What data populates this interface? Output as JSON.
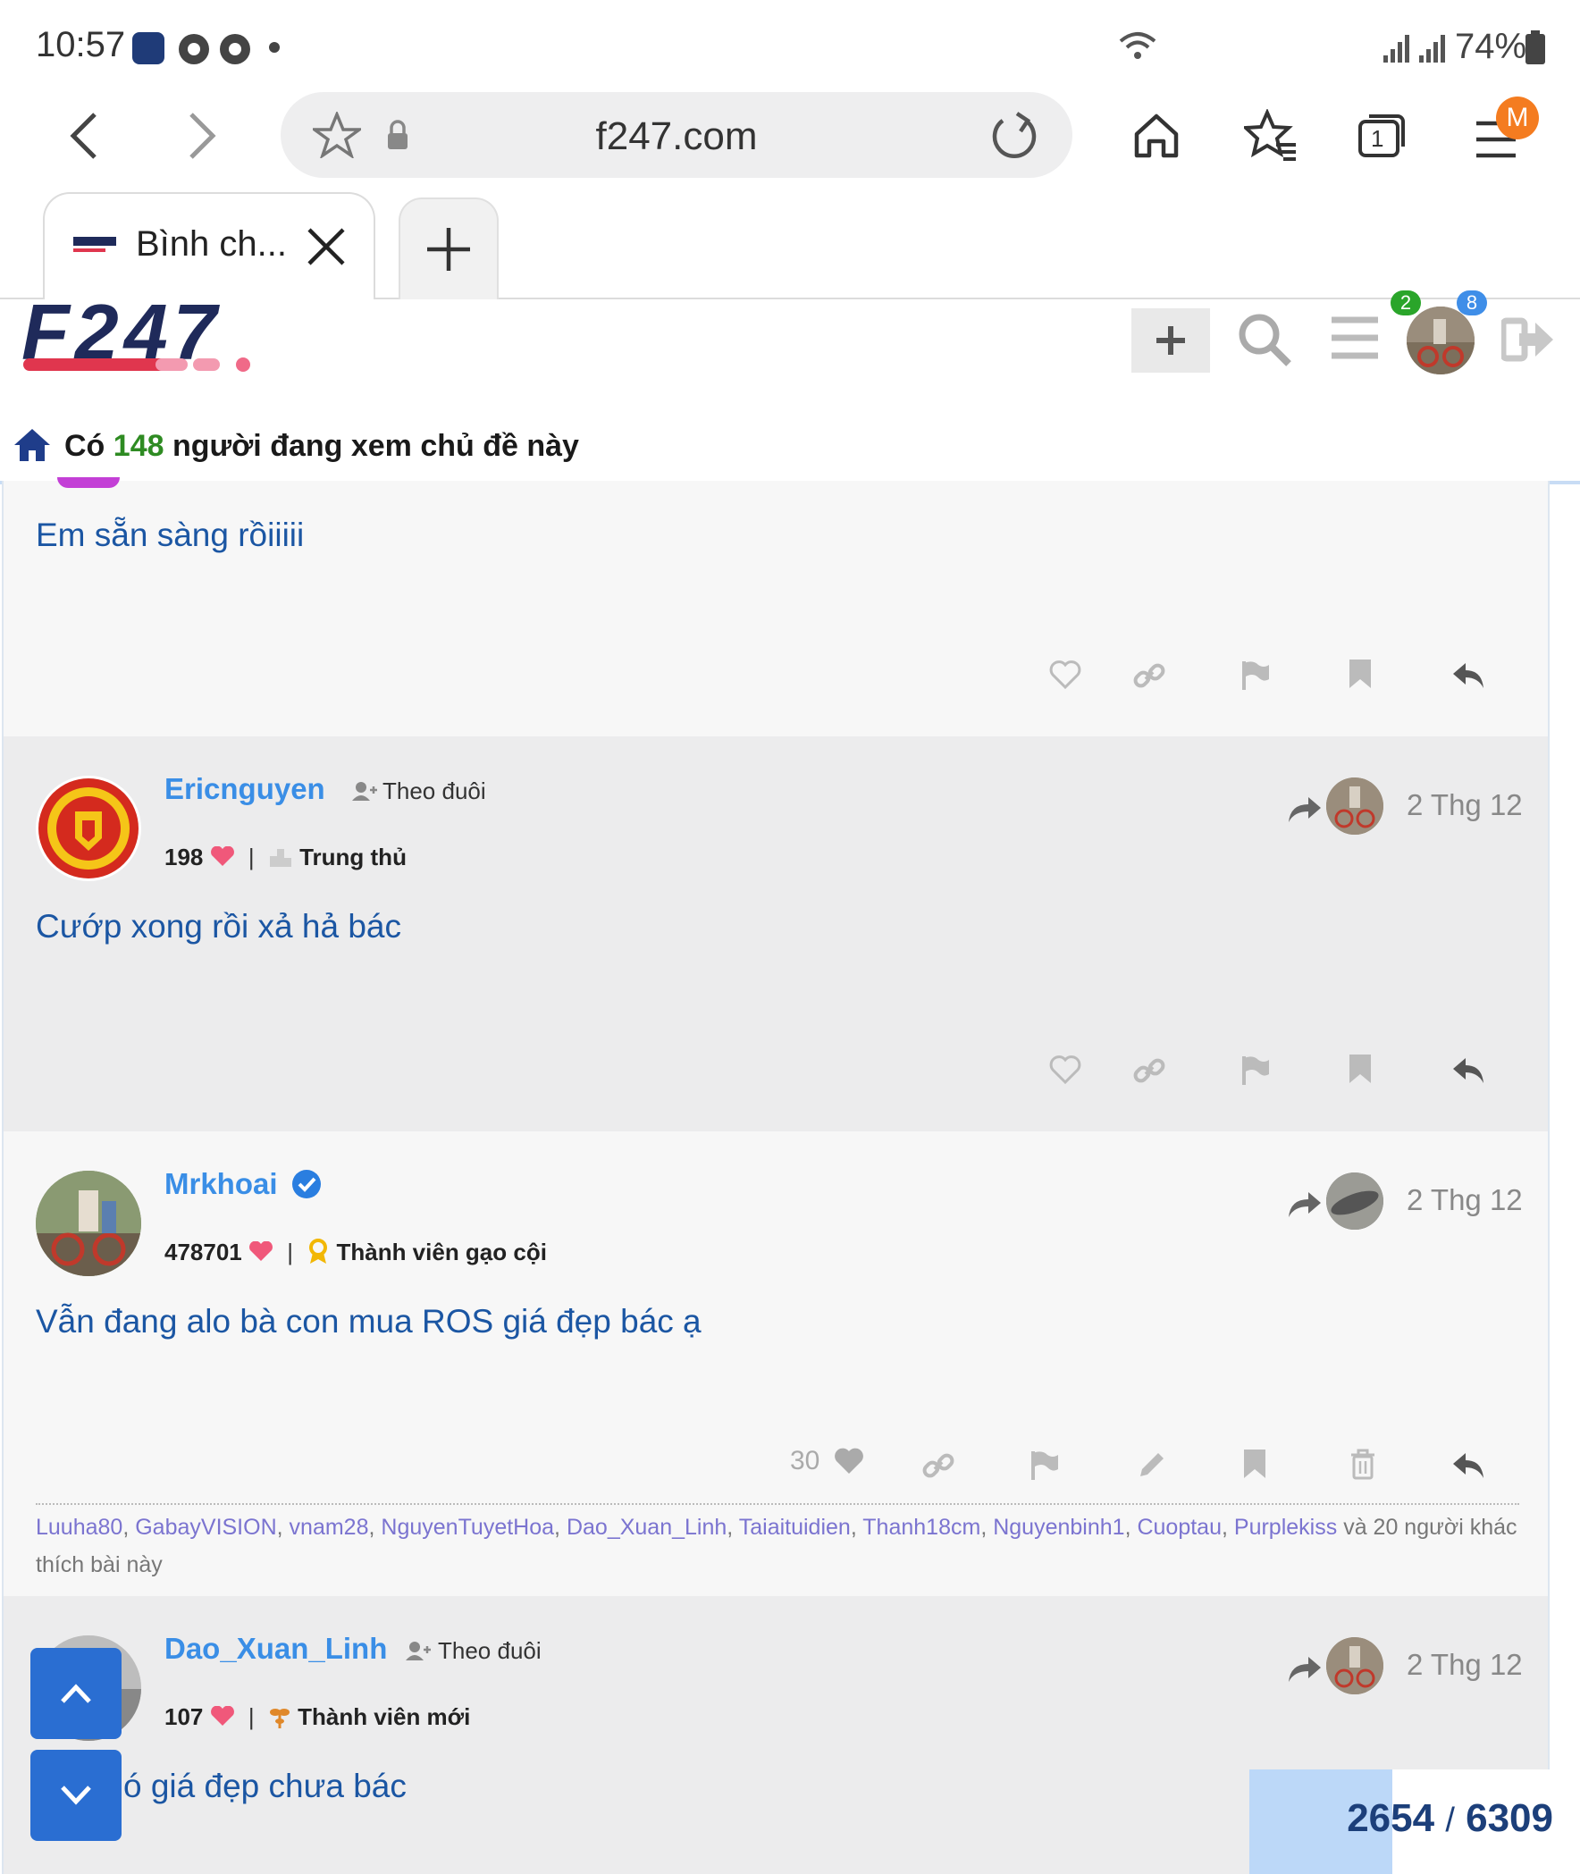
{
  "status_bar": {
    "time": "10:57",
    "battery": "74%",
    "icons": [
      "f247-app-icon",
      "chrome-icon",
      "chrome-icon",
      "dot-icon",
      "wifi-icon",
      "signal-icon",
      "signal-icon",
      "battery-icon"
    ]
  },
  "browser": {
    "url": "f247.com",
    "menu_badge": "M",
    "tab_count": "1",
    "tab_title": "Bình ch..."
  },
  "site": {
    "logo_text": "F247",
    "notif_badge_green": "2",
    "notif_badge_blue": "8"
  },
  "viewing": {
    "prefix": "Có",
    "count": "148",
    "suffix": "người đang xem chủ đề này"
  },
  "posts": [
    {
      "body": "Em sẵn sàng rồiiiii"
    },
    {
      "username": "Ericnguyen",
      "follow_label": "Theo đuôi",
      "likes": "198",
      "rank": "Trung thủ",
      "date": "2 Thg 12",
      "body": "Cướp xong rồi xả hả bác"
    },
    {
      "username": "Mrkhoai",
      "likes": "478701",
      "rank": "Thành viên gạo cội",
      "date": "2 Thg 12",
      "body": "Vẫn đang alo bà con mua ROS giá đẹp bác ạ",
      "like_count": "30",
      "likers": [
        "Luuha80",
        "GabayVISION",
        "vnam28",
        "NguyenTuyetHoa",
        "Dao_Xuan_Linh",
        "Taiaituidien",
        "Thanh18cm",
        "Nguyenbinh1",
        "Cuoptau",
        "Purplekiss"
      ],
      "likers_suffix": "và 20 người khác thích bài này"
    },
    {
      "username": "Dao_Xuan_Linh",
      "follow_label": "Theo đuôi",
      "likes": "107",
      "rank": "Thành viên mới",
      "date": "2 Thg 12",
      "body": "ó giá đẹp chưa bác"
    }
  ],
  "pager": {
    "current": "2654",
    "separator": "/",
    "total": "6309"
  },
  "colors": {
    "accent_blue": "#2a6ed2",
    "username_blue": "#3a8ee6",
    "body_blue": "#1b56a3",
    "viewer_green": "#2e8b22",
    "heart_pink": "#f0587a"
  }
}
